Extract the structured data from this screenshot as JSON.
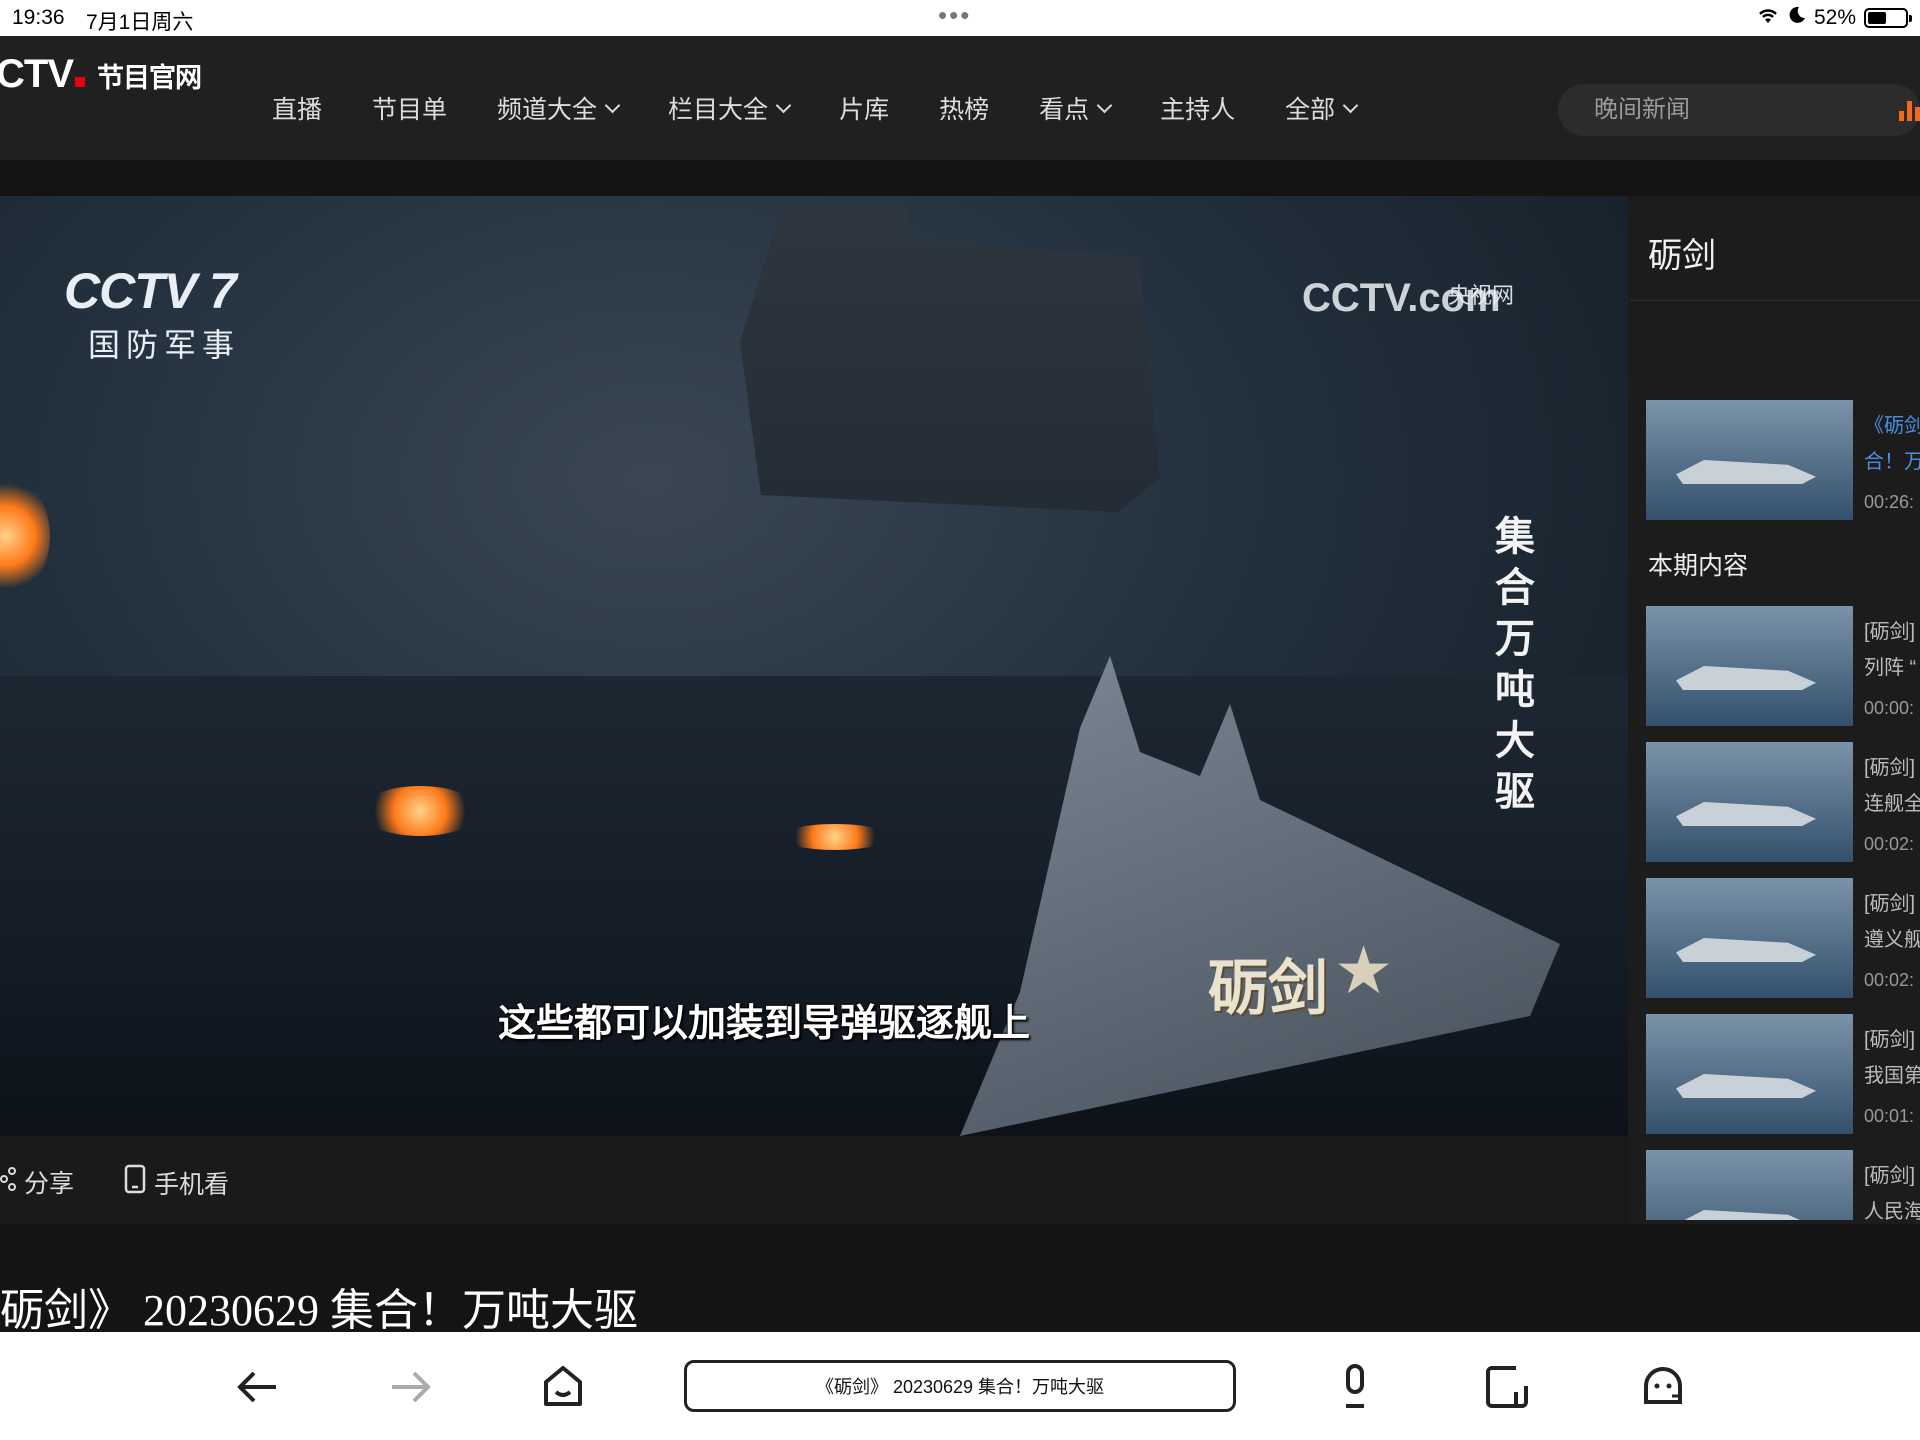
{
  "status": {
    "time": "19:36",
    "date": "7月1日周六",
    "dots": "•••",
    "battery": "52%"
  },
  "nav": {
    "logo": "CTV",
    "logo_sub": "节目官网",
    "items": [
      {
        "label": "直播",
        "dropdown": false
      },
      {
        "label": "节目单",
        "dropdown": false
      },
      {
        "label": "频道大全",
        "dropdown": true
      },
      {
        "label": "栏目大全",
        "dropdown": true
      },
      {
        "label": "片库",
        "dropdown": false
      },
      {
        "label": "热榜",
        "dropdown": false
      },
      {
        "label": "看点",
        "dropdown": true
      },
      {
        "label": "主持人",
        "dropdown": false
      },
      {
        "label": "全部",
        "dropdown": true
      }
    ],
    "search_placeholder": "晚间新闻"
  },
  "video": {
    "channel_logo": "CCTV 7",
    "channel_sub": "国防军事",
    "watermark": "CCTV.com",
    "watermark_sub": "央视网",
    "vertical_title": "集合万吨大驱",
    "caption": "这些都可以加装到导弹驱逐舰上",
    "show_logo": "砺剑"
  },
  "actions": {
    "share": "分享",
    "mobile": "手机看"
  },
  "panel": {
    "title": "砺剑",
    "featured": {
      "line1": "《砺剑",
      "line2": "合！万",
      "duration": "00:26:"
    },
    "section": "本期内容",
    "items": [
      {
        "line1": "[砺剑]",
        "line2": "列阵 “",
        "duration": "00:00:"
      },
      {
        "line1": "[砺剑]",
        "line2": "连舰全",
        "duration": "00:02:"
      },
      {
        "line1": "[砺剑]",
        "line2": "遵义舰",
        "duration": "00:02:"
      },
      {
        "line1": "[砺剑]",
        "line2": "我国第",
        "duration": "00:01:"
      },
      {
        "line1": "[砺剑]",
        "line2": "人民海",
        "duration": ""
      }
    ]
  },
  "page_title": "砺剑》 20230629 集合！万吨大驱",
  "toolbar": {
    "url": "《砺剑》 20230629 集合！万吨大驱"
  },
  "colors": {
    "accent": "#e60012",
    "link": "#4a8fe0",
    "bars": "#f26b1d"
  }
}
